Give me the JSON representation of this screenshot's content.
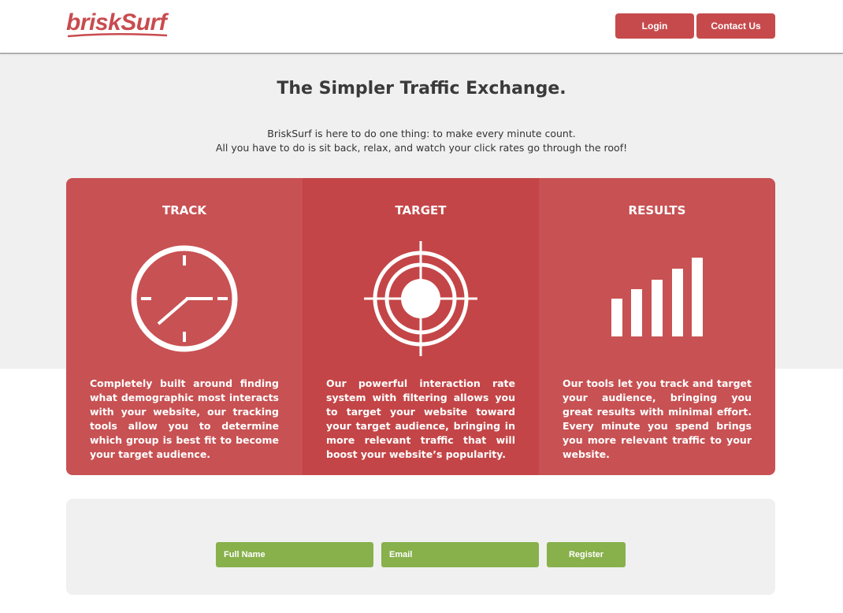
{
  "header": {
    "logo_text": "briskSurf",
    "login_label": "Login",
    "contact_label": "Contact Us"
  },
  "hero": {
    "title": "The Simpler Traffic Exchange.",
    "subtitle_line1": "BriskSurf is here to do one thing: to make every minute count.",
    "subtitle_line2": "All you have to do is sit back, relax, and watch your click rates go through the roof!"
  },
  "features": [
    {
      "title": "TRACK",
      "icon": "clock-icon",
      "description": "Completely built around finding what demographic most interacts with your website, our tracking tools allow you to determine which group is best fit to become your target audience."
    },
    {
      "title": "TARGET",
      "icon": "target-icon",
      "description": "Our powerful interaction rate system with filtering allows you to target your website toward your target audience, bringing in more relevant traffic that will boost your website’s popularity."
    },
    {
      "title": "RESULTS",
      "icon": "bar-chart-icon",
      "description": "Our tools let you track and target your audience, bringing you great results with minimal effort. Every minute you spend brings you more relevant traffic to your website."
    }
  ],
  "signup": {
    "name_placeholder": "Full Name",
    "email_placeholder": "Email",
    "register_label": "Register"
  },
  "colors": {
    "brand_red": "#c64a4c",
    "feature_red": "#c85153",
    "feature_red_dark": "#c44547",
    "signup_green": "#88b04b",
    "hero_bg": "#f0f0f0"
  }
}
